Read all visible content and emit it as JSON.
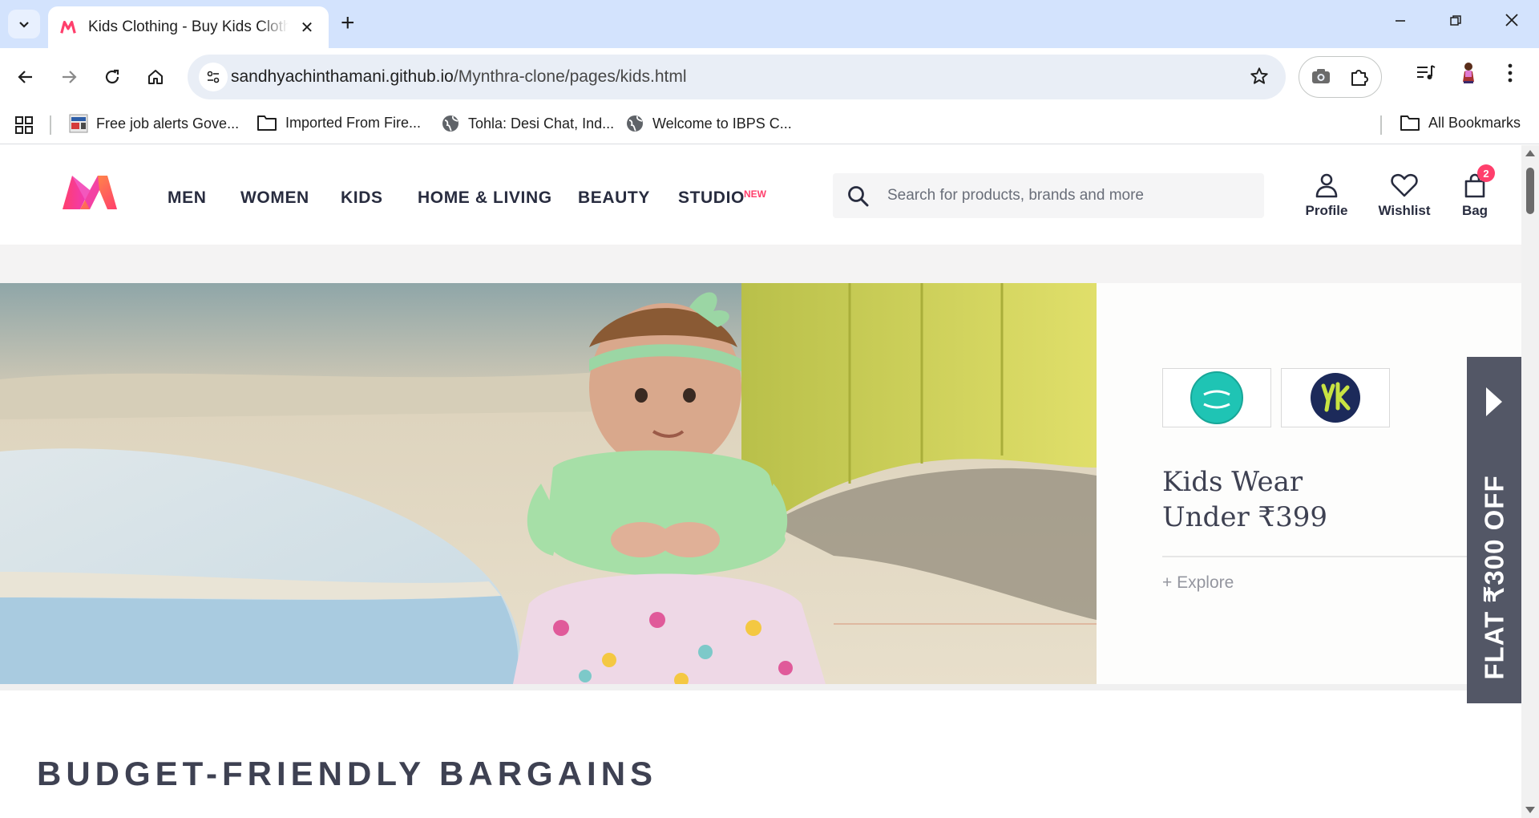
{
  "browser": {
    "tab_title": "Kids Clothing - Buy Kids Clothes",
    "url_host": "sandhyachinthamani.github.io",
    "url_path": "/Mynthra-clone/pages/kids.html",
    "bookmarks": [
      {
        "label": "Free job alerts Gove...",
        "icon": "site-favicon-icon"
      },
      {
        "label": "Imported From Fire...",
        "icon": "folder-icon"
      },
      {
        "label": "Tohla: Desi Chat, Ind...",
        "icon": "globe-icon"
      },
      {
        "label": "Welcome to IBPS C...",
        "icon": "globe-icon"
      }
    ],
    "all_bookmarks": "All Bookmarks"
  },
  "header": {
    "nav": [
      "MEN",
      "WOMEN",
      "KIDS",
      "HOME & LIVING",
      "BEAUTY",
      "STUDIO"
    ],
    "new_badge": "NEW",
    "search_placeholder": "Search for products, brands and more",
    "profile": "Profile",
    "wishlist": "Wishlist",
    "bag": "Bag",
    "bag_count": "2"
  },
  "banner": {
    "brands": [
      "mini klub",
      "yk"
    ],
    "title_line1": "Kids Wear",
    "title_line2": "Under ₹399",
    "explore": "+ Explore"
  },
  "offer_tab": {
    "text": "FLAT ₹300 OFF"
  },
  "sections": {
    "title": "BUDGET-FRIENDLY BARGAINS"
  },
  "colors": {
    "accent": "#ff3f6c",
    "text_dark": "#282c3f",
    "offer_bg": "#535766"
  }
}
